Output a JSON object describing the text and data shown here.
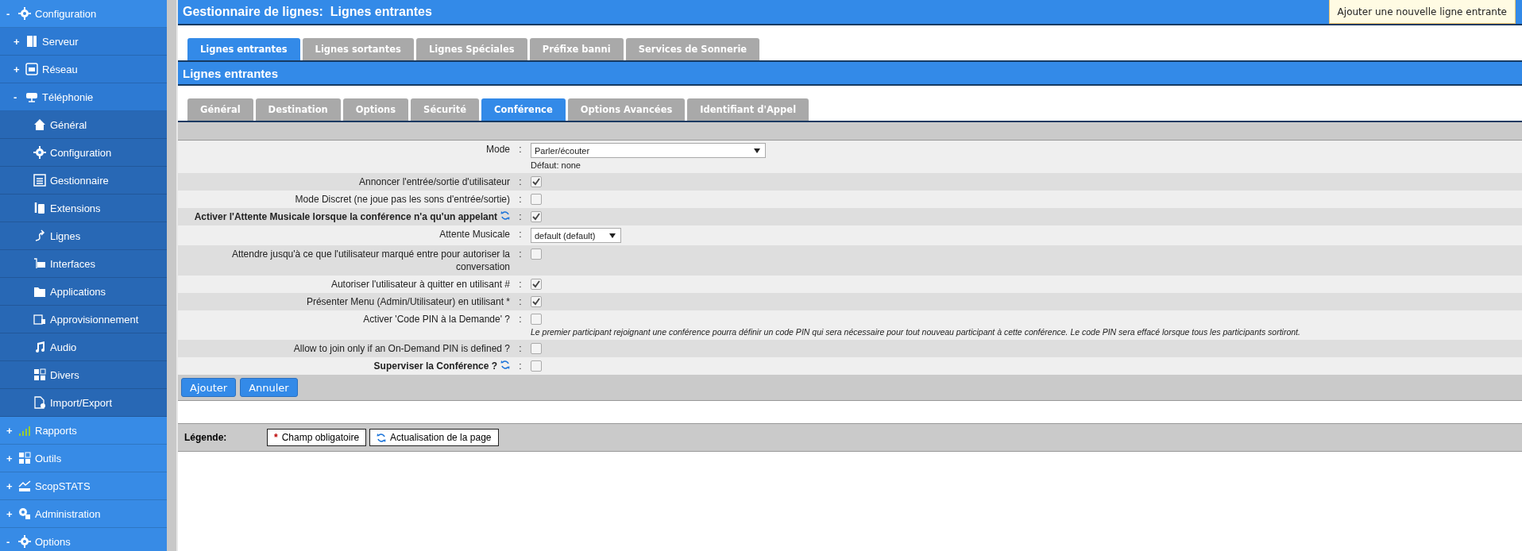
{
  "sidebar": {
    "items": [
      {
        "label": "Configuration",
        "toggle": "-",
        "children": [
          {
            "label": "Serveur",
            "toggle": "+"
          },
          {
            "label": "Réseau",
            "toggle": "+"
          },
          {
            "label": "Téléphonie",
            "toggle": "-",
            "children": [
              {
                "label": "Général"
              },
              {
                "label": "Configuration"
              },
              {
                "label": "Gestionnaire"
              },
              {
                "label": "Extensions"
              },
              {
                "label": "Lignes"
              },
              {
                "label": "Interfaces"
              },
              {
                "label": "Applications"
              },
              {
                "label": "Approvisionnement"
              },
              {
                "label": "Audio"
              },
              {
                "label": "Divers"
              },
              {
                "label": "Import/Export"
              }
            ]
          }
        ]
      },
      {
        "label": "Rapports",
        "toggle": "+"
      },
      {
        "label": "Outils",
        "toggle": "+"
      },
      {
        "label": "ScopSTATS",
        "toggle": "+"
      },
      {
        "label": "Administration",
        "toggle": "+"
      },
      {
        "label": "Options",
        "toggle": "-"
      }
    ]
  },
  "header": {
    "title": "Gestionnaire de lignes:  Lignes entrantes",
    "add_button": "Ajouter une nouvelle ligne entrante"
  },
  "tabs": [
    {
      "label": "Lignes entrantes",
      "selected": true
    },
    {
      "label": "Lignes sortantes",
      "selected": false
    },
    {
      "label": "Lignes Spéciales",
      "selected": false
    },
    {
      "label": "Préfixe banni",
      "selected": false
    },
    {
      "label": "Services de Sonnerie",
      "selected": false
    }
  ],
  "section_title": "Lignes entrantes",
  "subtabs": [
    {
      "label": "Général",
      "selected": false
    },
    {
      "label": "Destination",
      "selected": false
    },
    {
      "label": "Options",
      "selected": false
    },
    {
      "label": "Sécurité",
      "selected": false
    },
    {
      "label": "Conférence",
      "selected": true
    },
    {
      "label": "Options Avancées",
      "selected": false
    },
    {
      "label": "Identifiant d'Appel",
      "selected": false
    }
  ],
  "form": {
    "separator": ":",
    "rows": [
      {
        "kind": "select",
        "label": "Mode",
        "emphasized": false,
        "value": "Parler/écouter",
        "wide": true,
        "hint": "Défaut: none"
      },
      {
        "kind": "checkbox",
        "label": "Annoncer l'entrée/sortie d'utilisateur",
        "emphasized": false,
        "checked": true
      },
      {
        "kind": "checkbox",
        "label": "Mode Discret (ne joue pas les sons d'entrée/sortie)",
        "emphasized": false,
        "checked": false
      },
      {
        "kind": "checkbox",
        "label": "Activer l'Attente Musicale lorsque la conférence n'a qu'un appelant",
        "emphasized": true,
        "checked": true
      },
      {
        "kind": "select",
        "label": "Attente Musicale",
        "emphasized": false,
        "value": "default (default)",
        "wide": false
      },
      {
        "kind": "checkbox",
        "label": "Attendre jusqu'à ce que l'utilisateur marqué entre pour autoriser la conversation",
        "emphasized": false,
        "checked": false
      },
      {
        "kind": "checkbox",
        "label": "Autoriser l'utilisateur à quitter en utilisant #",
        "emphasized": false,
        "checked": true
      },
      {
        "kind": "checkbox",
        "label": "Présenter Menu (Admin/Utilisateur) en utilisant *",
        "emphasized": false,
        "checked": true
      },
      {
        "kind": "checkbox",
        "label": "Activer 'Code PIN à la Demande' ?",
        "emphasized": false,
        "checked": false,
        "note": "Le premier participant rejoignant une conférence pourra définir un code PIN qui sera nécessaire pour tout nouveau participant à cette conférence. Le code PIN sera effacé lorsque tous les participants sortiront."
      },
      {
        "kind": "checkbox",
        "label": "Allow to join only if an On-Demand PIN is defined ?",
        "emphasized": false,
        "checked": false
      },
      {
        "kind": "checkbox",
        "label": "Superviser la Conférence ?",
        "emphasized": true,
        "checked": false
      }
    ],
    "buttons": [
      "Ajouter",
      "Annuler"
    ]
  },
  "legend": {
    "title": "Légende:",
    "required_mark": "*",
    "required": "Champ obligatoire",
    "refresh": "Actualisation de la page"
  }
}
